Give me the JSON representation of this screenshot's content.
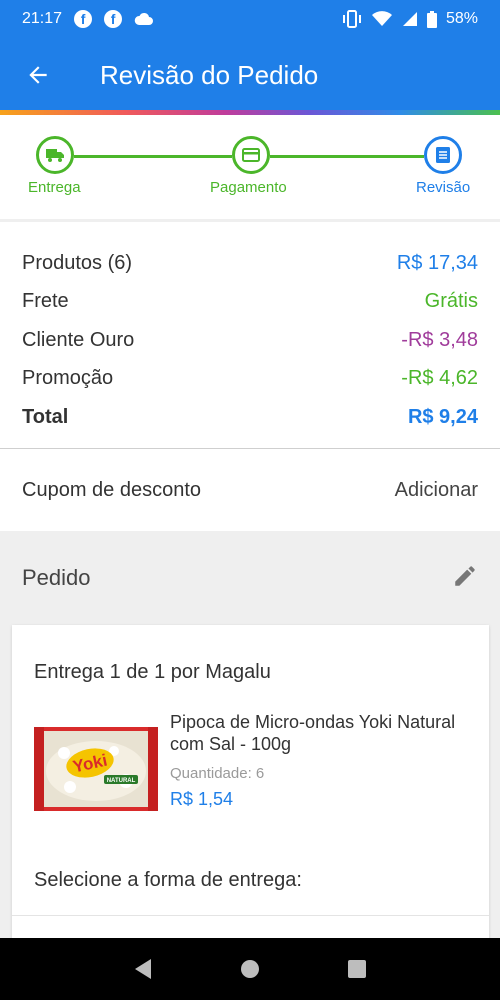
{
  "status_bar": {
    "time": "21:17",
    "battery": "58%",
    "icons": [
      "facebook-icon",
      "facebook-icon",
      "cloud-icon",
      "vibrate-icon",
      "wifi-icon",
      "signal-icon",
      "battery-icon"
    ]
  },
  "appbar": {
    "title": "Revisão do Pedido",
    "back_icon": "arrow-back-icon",
    "color": "#1f7fe8"
  },
  "steps": [
    {
      "label": "Entrega",
      "icon": "truck-icon",
      "state": "done"
    },
    {
      "label": "Pagamento",
      "icon": "card-icon",
      "state": "done"
    },
    {
      "label": "Revisão",
      "icon": "list-icon",
      "state": "active"
    }
  ],
  "summary": {
    "products_label": "Produtos (6)",
    "products_value": "R$ 17,34",
    "shipping_label": "Frete",
    "shipping_value": "Grátis",
    "gold_label": "Cliente Ouro",
    "gold_value": "-R$ 3,48",
    "promo_label": "Promoção",
    "promo_value": "-R$ 4,62",
    "total_label": "Total",
    "total_value": "R$ 9,24"
  },
  "coupon": {
    "label": "Cupom de desconto",
    "action": "Adicionar"
  },
  "order": {
    "title": "Pedido",
    "edit_icon": "pencil-icon"
  },
  "delivery": {
    "title": "Entrega 1 de 1 por Magalu",
    "product_name": "Pipoca de Micro-ondas Yoki Natural com Sal - 100g",
    "quantity_label": "Quantidade:",
    "quantity_value": "6",
    "price": "R$ 1,54",
    "brand": "Yoki",
    "package_text": "NATURAL",
    "select_label": "Selecione a forma de entrega:"
  },
  "colors": {
    "blue": "#1f7fe8",
    "green": "#4bb62a",
    "purple": "#a03c9b"
  },
  "nav": [
    "back-triangle-icon",
    "home-circle-icon",
    "recents-square-icon"
  ]
}
